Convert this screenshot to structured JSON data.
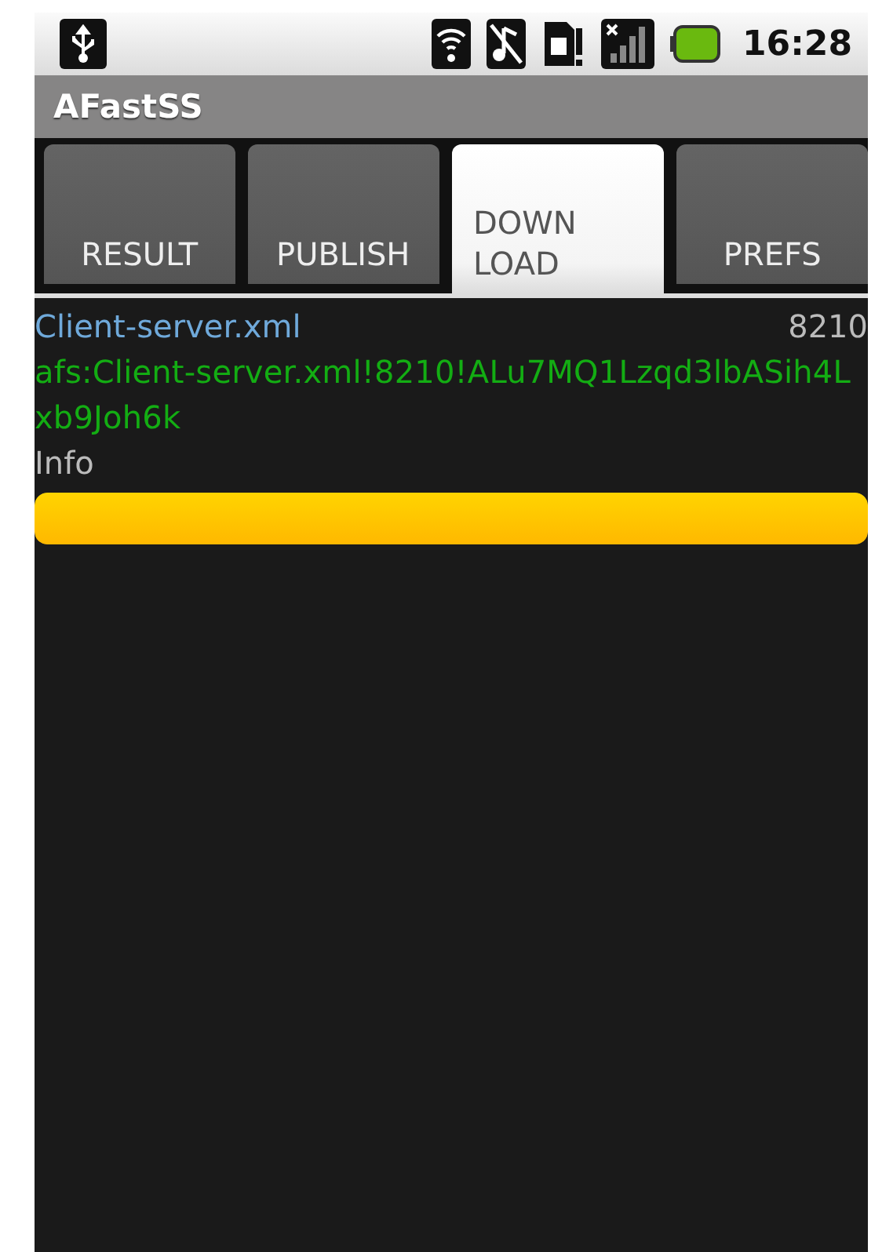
{
  "status_bar": {
    "time": "16:28"
  },
  "window": {
    "title": "AFastSS"
  },
  "tabs": [
    {
      "label": "RESULT",
      "selected": false
    },
    {
      "label": "PUBLISH",
      "selected": false
    },
    {
      "label": "DOWN\nLOAD",
      "selected": true
    },
    {
      "label": "PREFS",
      "selected": false
    }
  ],
  "download": {
    "file_name": "Client-server.xml",
    "size": "8210",
    "link": "afs:Client-server.xml!8210!ALu7MQ1Lzqd3lbASih4Lxb9Joh6k",
    "info": "Info",
    "level": 1
  }
}
